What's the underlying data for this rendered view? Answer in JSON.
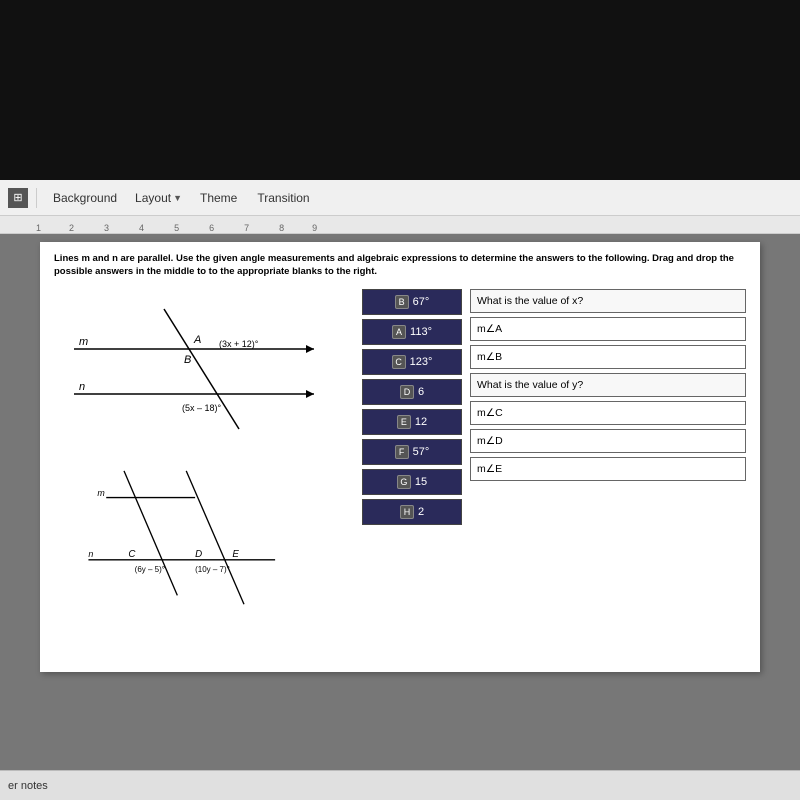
{
  "toolbar": {
    "icon_label": "⊞",
    "background_label": "Background",
    "layout_label": "Layout",
    "theme_label": "Theme",
    "transition_label": "Transition"
  },
  "ruler": {
    "marks": [
      "1",
      "2",
      "3",
      "4",
      "5",
      "6",
      "7",
      "8",
      "9"
    ]
  },
  "slide": {
    "instructions": "Lines m and n are parallel. Use the given angle measurements and algebraic expressions to determine the answers to the following. Drag and drop the possible answers in the middle to to the appropriate blanks to the right.",
    "diagram1": {
      "label_m": "m",
      "label_n": "n",
      "label_A": "A",
      "label_B": "B",
      "expr1": "(3x + 12)°",
      "expr2": "(5x – 18)°"
    },
    "diagram2": {
      "label_m": "m",
      "label_n": "n",
      "label_C": "C",
      "label_D": "D",
      "label_E": "E",
      "expr3": "(6y – 5)°",
      "expr4": "(10y – 7)°"
    },
    "answer_bank": [
      {
        "id": "B",
        "value": "67°"
      },
      {
        "id": "A",
        "value": "113°"
      },
      {
        "id": "C",
        "value": "123°"
      },
      {
        "id": "D",
        "value": "6"
      },
      {
        "id": "E",
        "value": "12"
      },
      {
        "id": "F",
        "value": "57°"
      },
      {
        "id": "G",
        "value": "15"
      },
      {
        "id": "H",
        "value": "2"
      }
    ],
    "answer_boxes": [
      {
        "label": "What is the value of x?",
        "is_question": true
      },
      {
        "label": "m∠A",
        "is_question": false
      },
      {
        "label": "m∠B",
        "is_question": false
      },
      {
        "label": "What is the value of y?",
        "is_question": true
      },
      {
        "label": "m∠C",
        "is_question": false
      },
      {
        "label": "m∠D",
        "is_question": false
      },
      {
        "label": "m∠E",
        "is_question": false
      }
    ]
  },
  "bottom_bar": {
    "notes_label": "er notes"
  }
}
